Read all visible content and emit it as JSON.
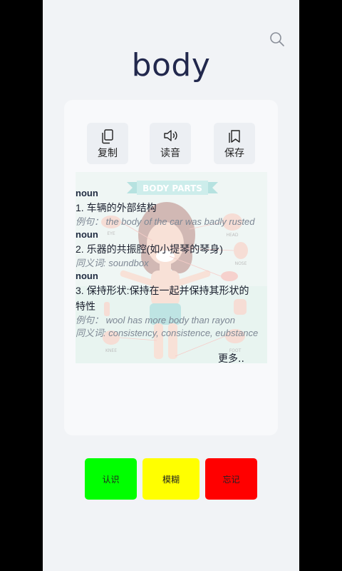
{
  "word": "body",
  "actions": {
    "copy": "复制",
    "read": "读音",
    "save": "保存"
  },
  "illustration": {
    "title": "BODY PARTS",
    "labels": [
      "EYE",
      "HEAD",
      "NOSE",
      "FOOT",
      "KNEE"
    ]
  },
  "definitions": [
    {
      "pos": "noun",
      "meaning": "1. 车辆的外部结构",
      "example": "例句：  the body of the car was badly rusted"
    },
    {
      "pos": "noun",
      "meaning": "2. 乐器的共振腔(如小提琴的琴身)",
      "synonym": "同义词: soundbox"
    },
    {
      "pos": "noun",
      "meaning_line1": "3. 保持形状:保持在一起并保持其形状的",
      "meaning_line2": "特性",
      "example": "例句：  wool has more body than rayon",
      "synonym": "同义词: consistency, consistence, eubstance"
    }
  ],
  "more_label": "更多..",
  "buttons": {
    "know": "认识",
    "vague": "模糊",
    "forgot": "忘记"
  },
  "colors": {
    "know": "#00ff00",
    "vague": "#ffff00",
    "forgot": "#ff0000"
  }
}
